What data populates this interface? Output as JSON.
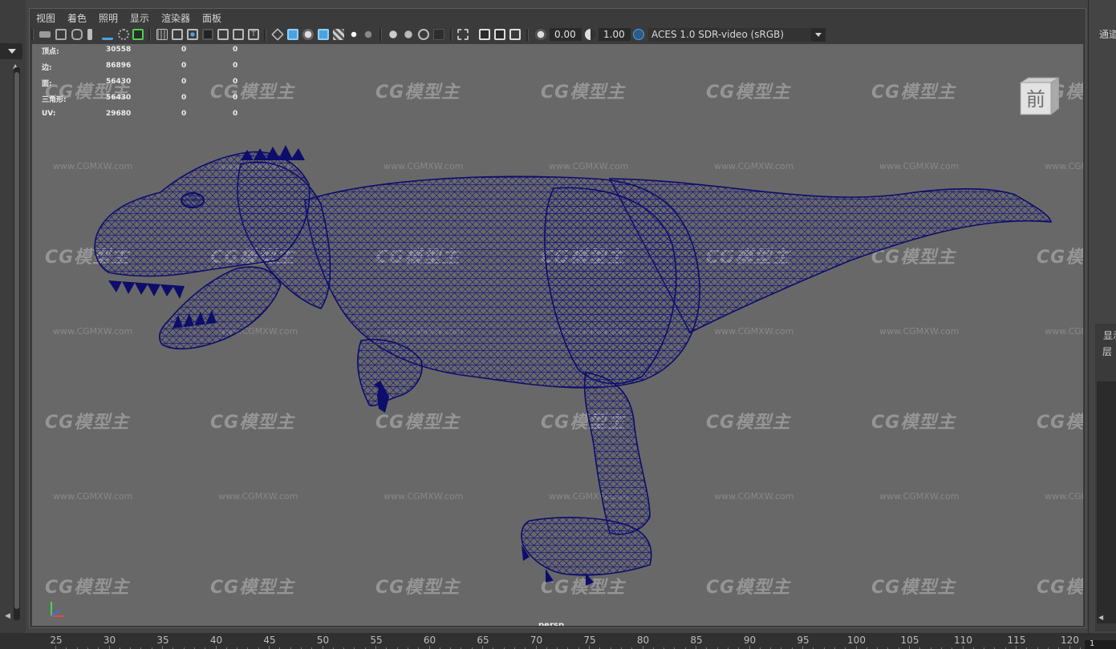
{
  "menu": [
    "视图",
    "着色",
    "照明",
    "显示",
    "渲染器",
    "面板"
  ],
  "toolbar": {
    "exposure_value": "0.00",
    "gamma_value": "1.00",
    "color_space": "ACES 1.0 SDR-video (sRGB)"
  },
  "hud": {
    "rows": [
      {
        "label": "顶点:",
        "count": "30558",
        "sel1": "0",
        "sel2": "0"
      },
      {
        "label": "边:",
        "count": "86896",
        "sel1": "0",
        "sel2": "0"
      },
      {
        "label": "面:",
        "count": "56430",
        "sel1": "0",
        "sel2": "0"
      },
      {
        "label": "三角形:",
        "count": "56430",
        "sel1": "0",
        "sel2": "0"
      },
      {
        "label": "UV:",
        "count": "29680",
        "sel1": "0",
        "sel2": "0"
      }
    ]
  },
  "viewcube_label": "前",
  "camera_label": "persp",
  "watermark": {
    "logo": "CG模型主",
    "url": "www.CGMXW.com"
  },
  "right_panel": {
    "channel_label": "通道",
    "display_label": "显示",
    "layer_label": "层"
  },
  "timeline": {
    "ticks": [
      "25",
      "30",
      "35",
      "40",
      "45",
      "50",
      "55",
      "60",
      "65",
      "70",
      "75",
      "80",
      "85",
      "90",
      "95",
      "100",
      "105",
      "110",
      "115",
      "120"
    ],
    "current_frame": "1"
  },
  "colors": {
    "wireframe": "#101070",
    "viewport_bg": "#686868",
    "ui_bg": "#444444"
  }
}
